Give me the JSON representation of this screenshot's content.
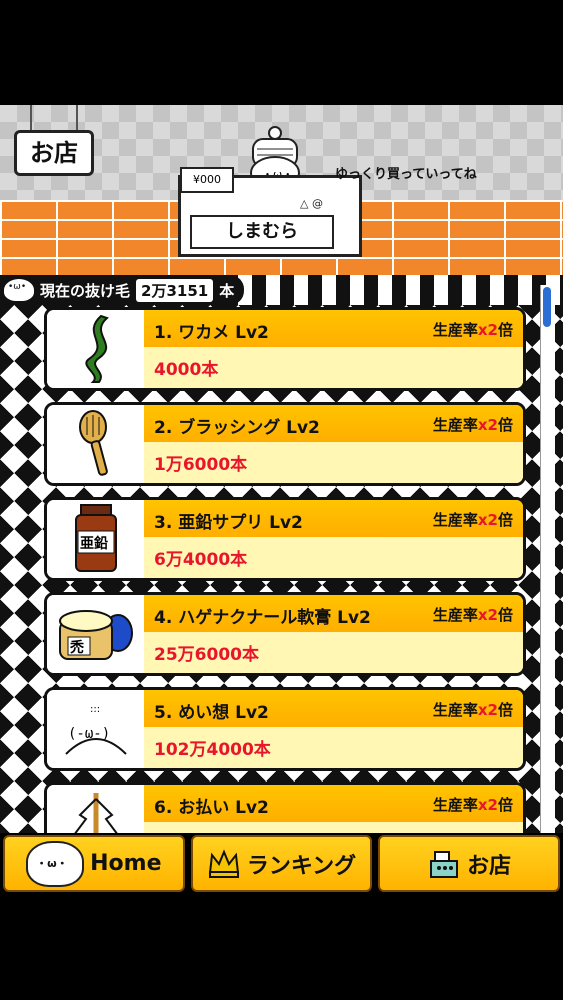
{
  "header": {
    "shop_sign": "お店",
    "register_label": "しまむら",
    "register_price": "¥000",
    "register_keys": "△ @",
    "clerk_face": "・ω・",
    "speech": "ゆっくり買っていってね"
  },
  "counter": {
    "label": "現在の抜け毛",
    "value": "2万3151",
    "unit": "本"
  },
  "items": [
    {
      "name": "1. ワカメ Lv2",
      "rate_prefix": "生産率",
      "rate_mult": "x2",
      "rate_suffix": "倍",
      "cost": "4000本",
      "icon": "seaweed-icon"
    },
    {
      "name": "2. ブラッシング Lv2",
      "rate_prefix": "生産率",
      "rate_mult": "x2",
      "rate_suffix": "倍",
      "cost": "1万6000本",
      "icon": "hairbrush-icon"
    },
    {
      "name": "3. 亜鉛サプリ Lv2",
      "rate_prefix": "生産率",
      "rate_mult": "x2",
      "rate_suffix": "倍",
      "cost": "6万4000本",
      "icon": "zinc-supplement-icon",
      "icon_text": "亜鉛"
    },
    {
      "name": "4. ハゲナクナール軟膏 Lv2",
      "rate_prefix": "生産率",
      "rate_mult": "x2",
      "rate_suffix": "倍",
      "cost": "25万6000本",
      "icon": "ointment-jar-icon",
      "icon_text": "禿"
    },
    {
      "name": "5. めい想 Lv2",
      "rate_prefix": "生産率",
      "rate_mult": "x2",
      "rate_suffix": "倍",
      "cost": "102万4000本",
      "icon": "meditation-face-icon",
      "icon_text": "(-ω-)"
    },
    {
      "name": "6. お払い Lv2",
      "rate_prefix": "生産率",
      "rate_mult": "x2",
      "rate_suffix": "倍",
      "cost": "",
      "icon": "purification-wand-icon"
    }
  ],
  "nav": {
    "home": "Home",
    "ranking": "ランキング",
    "shop": "お店"
  }
}
